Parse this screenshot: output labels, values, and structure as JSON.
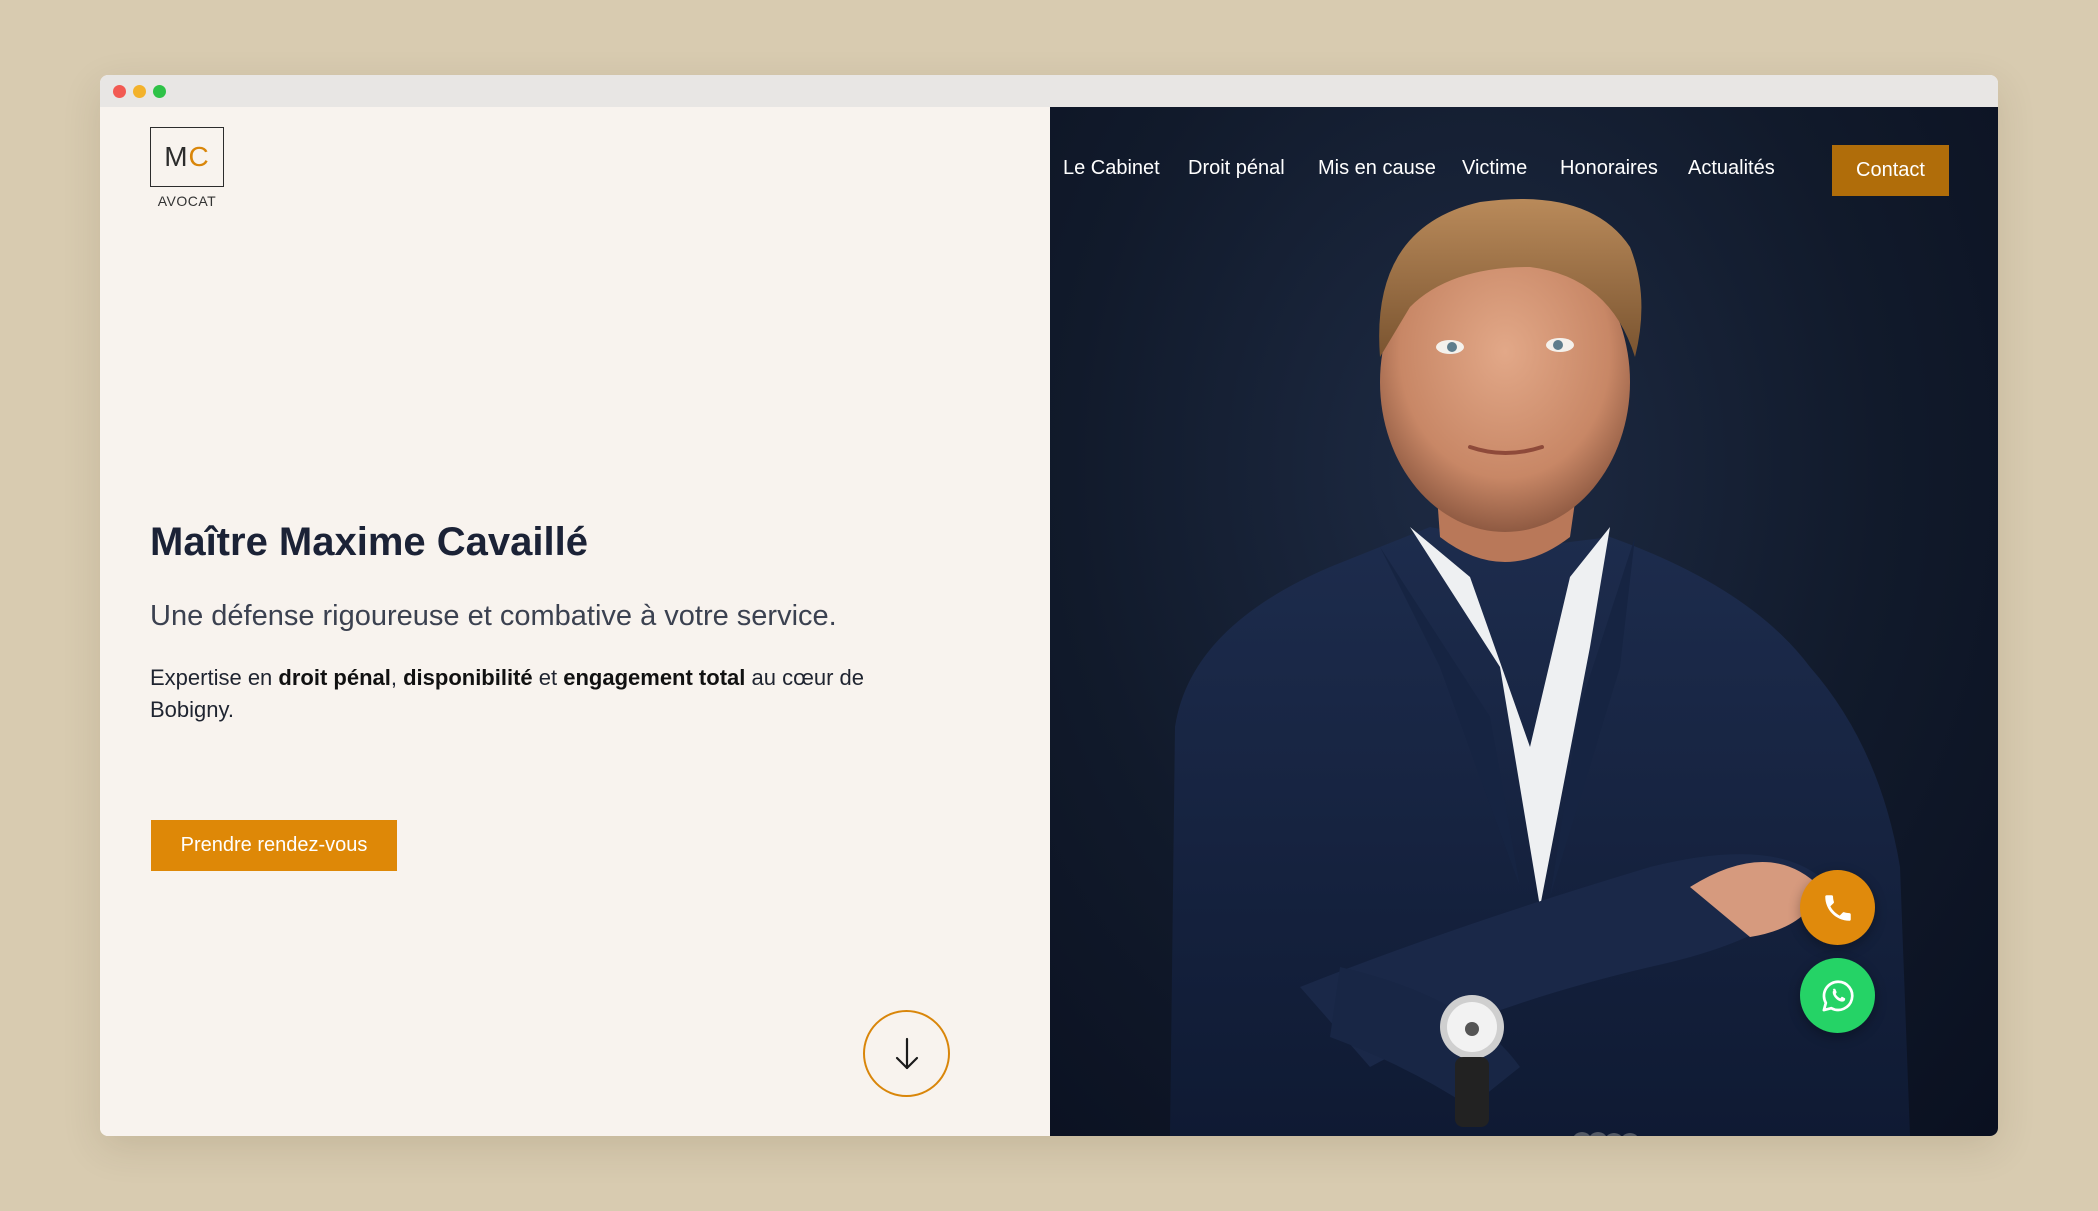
{
  "logo": {
    "initial_m": "M",
    "initial_c": "C",
    "subtitle": "AVOCAT"
  },
  "hero": {
    "title": "Maître Maxime Cavaillé",
    "subtitle": "Une défense rigoureuse et combative à votre service.",
    "desc_1": "Expertise en ",
    "desc_bold_1": "droit pénal",
    "desc_2": ", ",
    "desc_bold_2": "disponibilité",
    "desc_3": " et ",
    "desc_bold_3": "engagement total",
    "desc_4": " au cœur de Bobigny.",
    "cta_label": "Prendre rendez-vous"
  },
  "nav": {
    "items": [
      {
        "label": "Le Cabinet"
      },
      {
        "label": "Droit pénal"
      },
      {
        "label": "Mis en cause"
      },
      {
        "label": "Victime"
      },
      {
        "label": "Honoraires"
      },
      {
        "label": "Actualités"
      }
    ],
    "contact_label": "Contact"
  },
  "icons": {
    "scroll": "arrow-down-icon",
    "phone": "phone-icon",
    "whatsapp": "whatsapp-icon"
  },
  "colors": {
    "accent": "#de8807",
    "background": "#f8f3ee",
    "hero_dark": "#111a2b",
    "whatsapp": "#25d366"
  }
}
